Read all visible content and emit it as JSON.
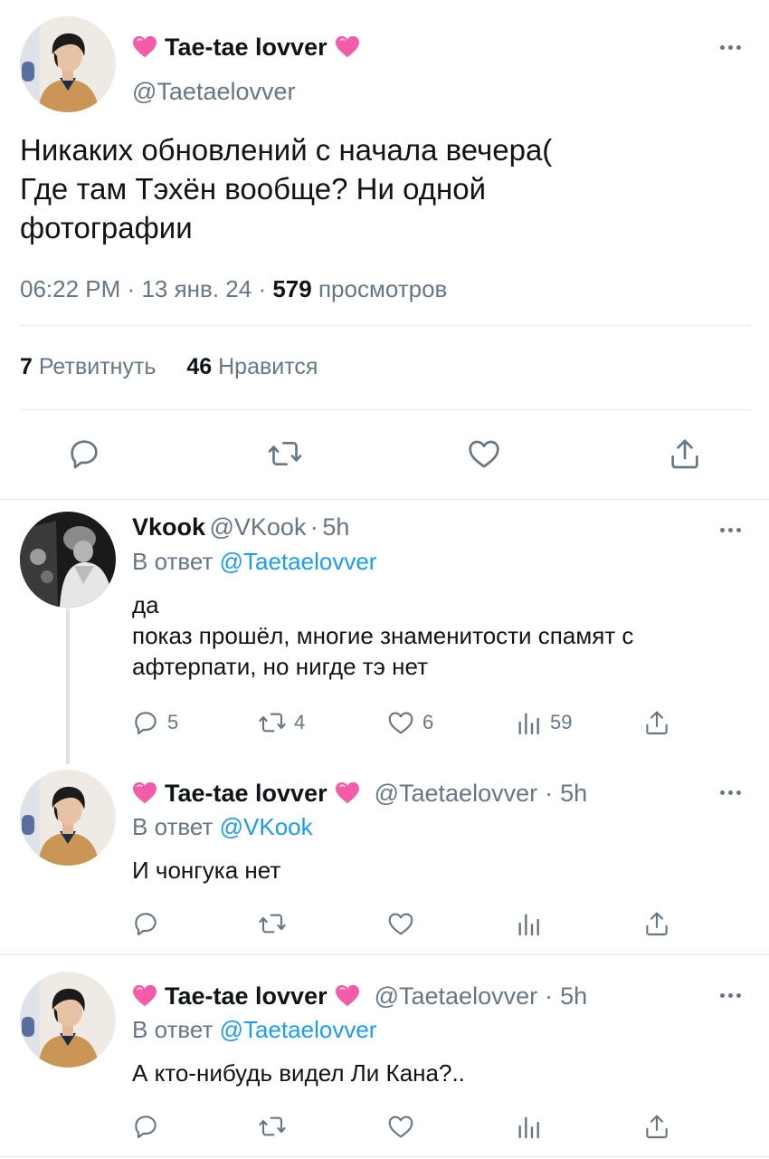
{
  "main_tweet": {
    "name": "Tae-tae lovver",
    "handle": "@Taetaelovver",
    "text_lines": [
      "Никаких обновлений с начала вечера(",
      "Где там Тэхён вообще? Ни одной",
      "фотографии"
    ],
    "time": "06:22 PM",
    "date": "13 янв. 24",
    "views": "579",
    "views_label": "просмотров",
    "retweets": "7",
    "retweets_label": "Ретвитнуть",
    "likes": "46",
    "likes_label": "Нравится",
    "sep": "·"
  },
  "replies": [
    {
      "name": "Vkook",
      "handle": "@VKook",
      "time": "5h",
      "reply_prefix": "В ответ",
      "reply_to": "@Taetaelovver",
      "text": "да\nпоказ прошёл, многие знаменитости спамят с\nафтерпати, но нигде тэ нет",
      "reply_count": "5",
      "retweet_count": "4",
      "like_count": "6",
      "view_count": "59"
    },
    {
      "name": "Tae-tae lovver",
      "handle": "@Taetaelovver",
      "time": "5h",
      "reply_prefix": "В ответ",
      "reply_to": "@VKook",
      "text": "И чонгука нет"
    },
    {
      "name": "Tae-tae lovver",
      "handle": "@Taetaelovver",
      "time": "5h",
      "reply_prefix": "В ответ",
      "reply_to": "@Taetaelovver",
      "text": "А кто-нибудь видел Ли Кана?.."
    }
  ],
  "icons": [
    "pink-heart-emoji",
    "more-icon",
    "reply-icon",
    "retweet-icon",
    "like-icon",
    "share-icon",
    "views-icon"
  ],
  "colors": {
    "accent": "#1d9bf0",
    "muted": "#657786",
    "heart": "#f25ca8"
  }
}
